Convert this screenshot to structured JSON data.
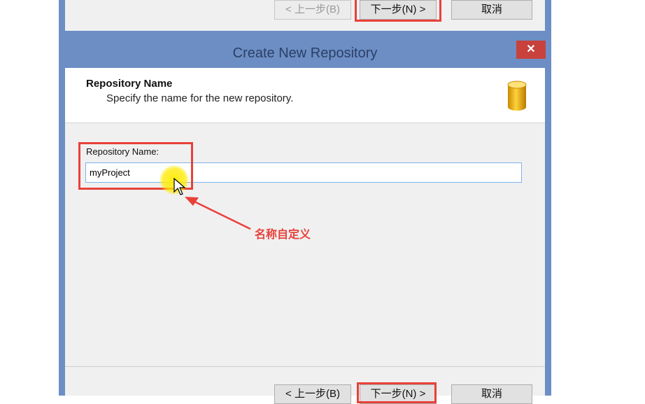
{
  "previous_dialog": {
    "back_label": "< 上一步(B)",
    "next_label": "下一步(N) >",
    "cancel_label": "取消"
  },
  "dialog": {
    "title": "Create New Repository",
    "close_symbol": "✕",
    "header": {
      "title": "Repository Name",
      "subtitle": "Specify the name for the new repository.",
      "icon": "database-icon"
    },
    "form": {
      "name_label": "Repository Name:",
      "name_value": "myProject"
    },
    "footer": {
      "back_label": "< 上一步(B)",
      "next_label": "下一步(N) >",
      "cancel_label": "取消"
    }
  },
  "annotation": {
    "text": "名称自定义",
    "color": "#e8413a"
  },
  "colors": {
    "frame": "#6c8ec4",
    "close": "#c8413c",
    "input_border": "#7eb4ea",
    "highlight": "#e8413a"
  }
}
